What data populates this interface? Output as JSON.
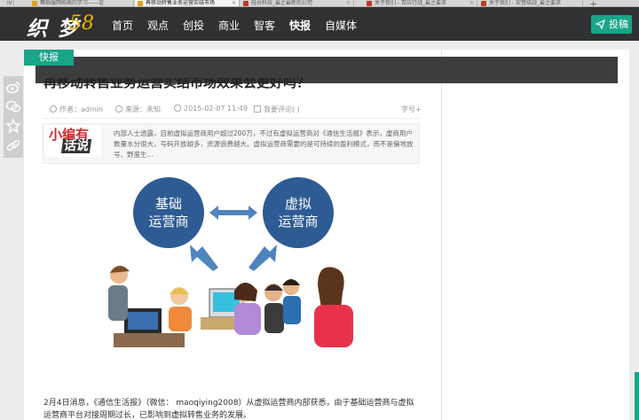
{
  "browser": {
    "tabs": [
      {
        "label": "IV",
        "active": false,
        "favicon": "#6c6c6c"
      },
      {
        "label": "舞蹈服网购高的学习——证",
        "active": false,
        "favicon": "#e1a21a"
      },
      {
        "label": "再移动转售业务运营实结市场",
        "active": true,
        "favicon": "#e1a21a"
      },
      {
        "label": "硅谷科技_最之最新的公司",
        "active": false,
        "favicon": "#c0392b"
      },
      {
        "label": "关于我们 - 百应行战_最之要求",
        "active": false,
        "favicon": "#c0392b"
      },
      {
        "label": "关于我们 - 安音结战_最之要求",
        "active": false,
        "favicon": "#c0392b"
      }
    ],
    "new_tab": "+"
  },
  "site": {
    "logo_text": "织 梦",
    "logo_number": "58",
    "nav": [
      "首页",
      "观点",
      "创投",
      "商业",
      "智客",
      "快报",
      "自媒体"
    ],
    "active_nav": "快报",
    "contribute_label": "投稿",
    "accent_color": "#19a587"
  },
  "article": {
    "category_badge": "快报",
    "title": "再移动转售业务运营实结市场效果会更好吗？",
    "meta": {
      "author": "作者：admin",
      "source": "来源：未知",
      "date": "2015-02-07 11:49",
      "comment": "我要评论(  )",
      "font_size": "字号+"
    },
    "editor_tag_line1": "小编有",
    "editor_tag_line2": "话说",
    "editor_summary": "内部人士透露，目前虚拟运营商用户超过200万，不过有虚拟运营商对《通信生活报》表示，虚商用户数量水分很大，号码开放越多，资源浪费越大。虚拟运营商需要的是可持续的盈利模式，而不是偏地放号、野蛮生...",
    "diagram": {
      "left_node": [
        "基础",
        "运营商"
      ],
      "right_node": [
        "虚拟",
        "运营商"
      ],
      "node_color": "#2e5b94"
    },
    "body_text": "2月4日消息，《通信生活报》（微信：  maoqiying2008）从虚拟运营商内部获悉，由于基础运营商与虚拟运营商平台对接周期过长，已影响到虚拟转售业务的发展。"
  },
  "share_icons": [
    "weibo-icon",
    "wechat-icon",
    "star-icon",
    "link-icon"
  ]
}
